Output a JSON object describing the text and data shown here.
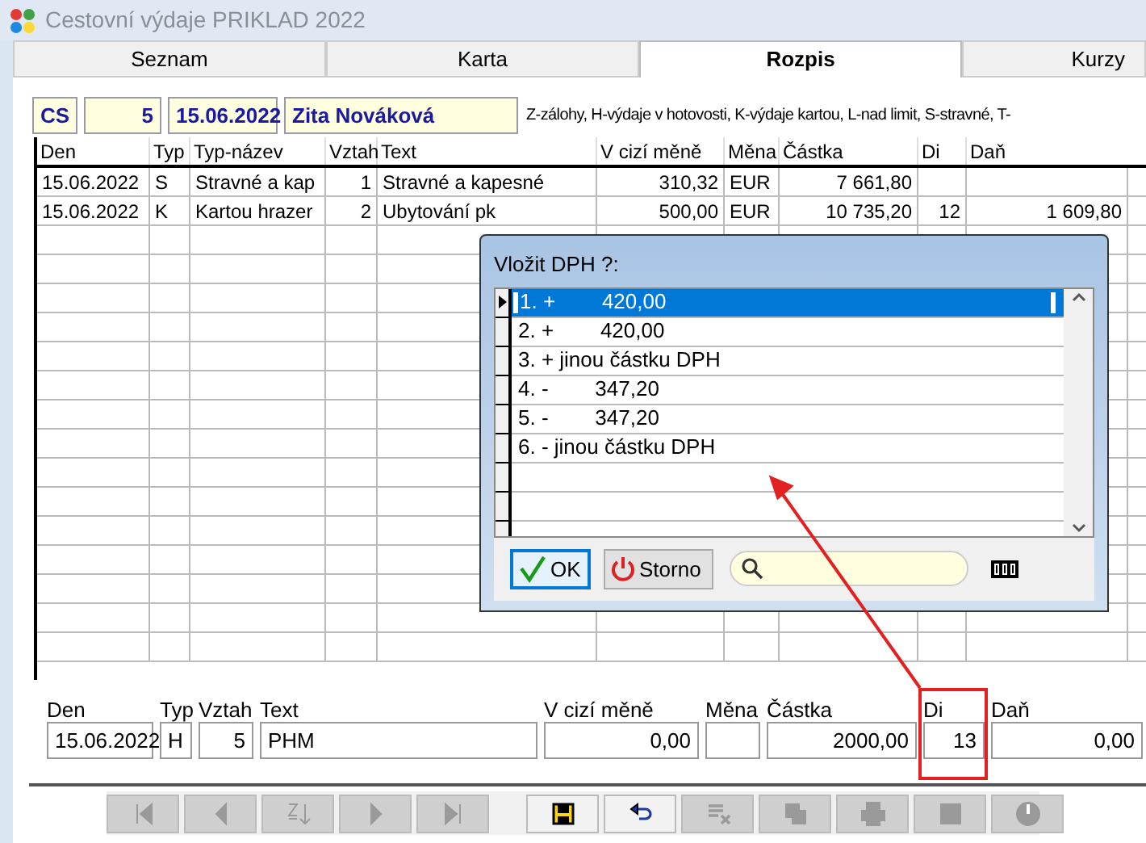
{
  "window": {
    "title": "Cestovní výdaje PRIKLAD 2022"
  },
  "tabs": [
    {
      "label": "Seznam",
      "selected": false
    },
    {
      "label": "Karta",
      "selected": false
    },
    {
      "label": "Rozpis",
      "selected": true
    },
    {
      "label": "Kurzy",
      "selected": false
    }
  ],
  "header": {
    "code": "CS",
    "number": "5",
    "date": "15.06.2022",
    "name": "Zita Nováková",
    "legend": "Z-zálohy, H-výdaje v hotovosti, K-výdaje kartou, L-nad limit, S-stravné, T-"
  },
  "table": {
    "columns": [
      "Den",
      "Typ",
      "Typ-název",
      "Vztah",
      "Text",
      "V cizí měně",
      "Měna",
      "Částka",
      "Di",
      "Daň"
    ],
    "rows": [
      [
        "15.06.2022",
        "S",
        "Stravné a kap",
        "1",
        "Stravné a kapesné",
        "310,32",
        "EUR",
        "7 661,80",
        "",
        ""
      ],
      [
        "15.06.2022",
        "K",
        "Kartou hrazer",
        "2",
        "Ubytování pk",
        "500,00",
        "EUR",
        "10 735,20",
        "12",
        "1 609,80"
      ]
    ]
  },
  "dialog": {
    "title": "Vložit DPH ?:",
    "items": [
      {
        "label": "1. +        420,00",
        "selected": true
      },
      {
        "label": "2. +        420,00",
        "selected": false
      },
      {
        "label": "3. + jinou částku DPH",
        "selected": false
      },
      {
        "label": "4. -        347,20",
        "selected": false
      },
      {
        "label": "5. -        347,20",
        "selected": false
      },
      {
        "label": "6. - jinou částku DPH",
        "selected": false
      }
    ],
    "buttons": [
      {
        "label": "OK",
        "kind": "ok"
      },
      {
        "label": "Storno",
        "kind": "cancel"
      }
    ]
  },
  "form": {
    "fields": [
      {
        "label": "Den",
        "value": "15.06.2022",
        "kind": "text"
      },
      {
        "label": "Typ",
        "value": "H",
        "kind": "text"
      },
      {
        "label": "Vztah",
        "value": "5",
        "kind": "number"
      },
      {
        "label": "Text",
        "value": "PHM",
        "kind": "text"
      },
      {
        "label": "V cizí měně",
        "value": "0,00",
        "kind": "number"
      },
      {
        "label": "Měna",
        "kind": "text"
      },
      {
        "label": "Částka",
        "value": "2000,00",
        "kind": "number"
      },
      {
        "label": "Di",
        "value": "13",
        "kind": "number"
      },
      {
        "label": "Daň",
        "value": "0,00",
        "kind": "number"
      }
    ]
  },
  "toolbar": [
    {
      "kind": "first",
      "disabled": true
    },
    {
      "kind": "prev",
      "disabled": true
    },
    {
      "kind": "sort",
      "disabled": true
    },
    {
      "kind": "next",
      "disabled": true
    },
    {
      "kind": "last",
      "disabled": true
    },
    {
      "kind": "save",
      "disabled": false
    },
    {
      "kind": "undo",
      "disabled": false
    },
    {
      "kind": "delete",
      "disabled": true
    },
    {
      "kind": "copy",
      "disabled": true
    },
    {
      "kind": "print",
      "disabled": true
    },
    {
      "kind": "stop",
      "disabled": true
    },
    {
      "kind": "power",
      "disabled": true
    }
  ]
}
